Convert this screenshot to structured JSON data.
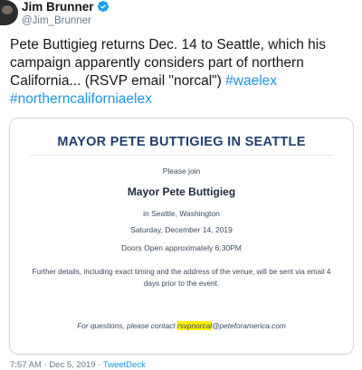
{
  "author": {
    "display_name": "Jim Brunner",
    "handle": "@Jim_Brunner",
    "verified_icon": "verified-badge-icon",
    "verified_color": "#1da1f2"
  },
  "tweet": {
    "text_main": "Pete Buttigieg returns Dec. 14 to Seattle, which his campaign apparently considers part of northern California... (RSVP email \"norcal\") ",
    "hashtag_1": "#waelex",
    "hashtag_2": "#northerncaliforniaelex",
    "hashtag_color": "#1b95e0"
  },
  "card": {
    "title": "MAYOR PETE BUTTIGIEG IN SEATTLE",
    "please_join": "Please join",
    "name": "Mayor Pete Buttigieg",
    "location": "in Seattle, Washington",
    "date": "Saturday, December 14, 2019",
    "doors": "Doors Open approximately 6:30PM",
    "details": "Further details, including exact timing and the address of the venue, will be sent via email 4 days prior to the event.",
    "contact_prefix": "For questions, please contact ",
    "contact_highlight": "rsvpnorcal",
    "contact_suffix": "@peteforamerica.com",
    "title_color": "#1f3f6e",
    "highlight_color": "#fff200"
  },
  "footer": {
    "time": "7:57 AM",
    "sep1": " · ",
    "date": "Dec 5, 2019",
    "sep2": " · ",
    "source": "TweetDeck"
  }
}
